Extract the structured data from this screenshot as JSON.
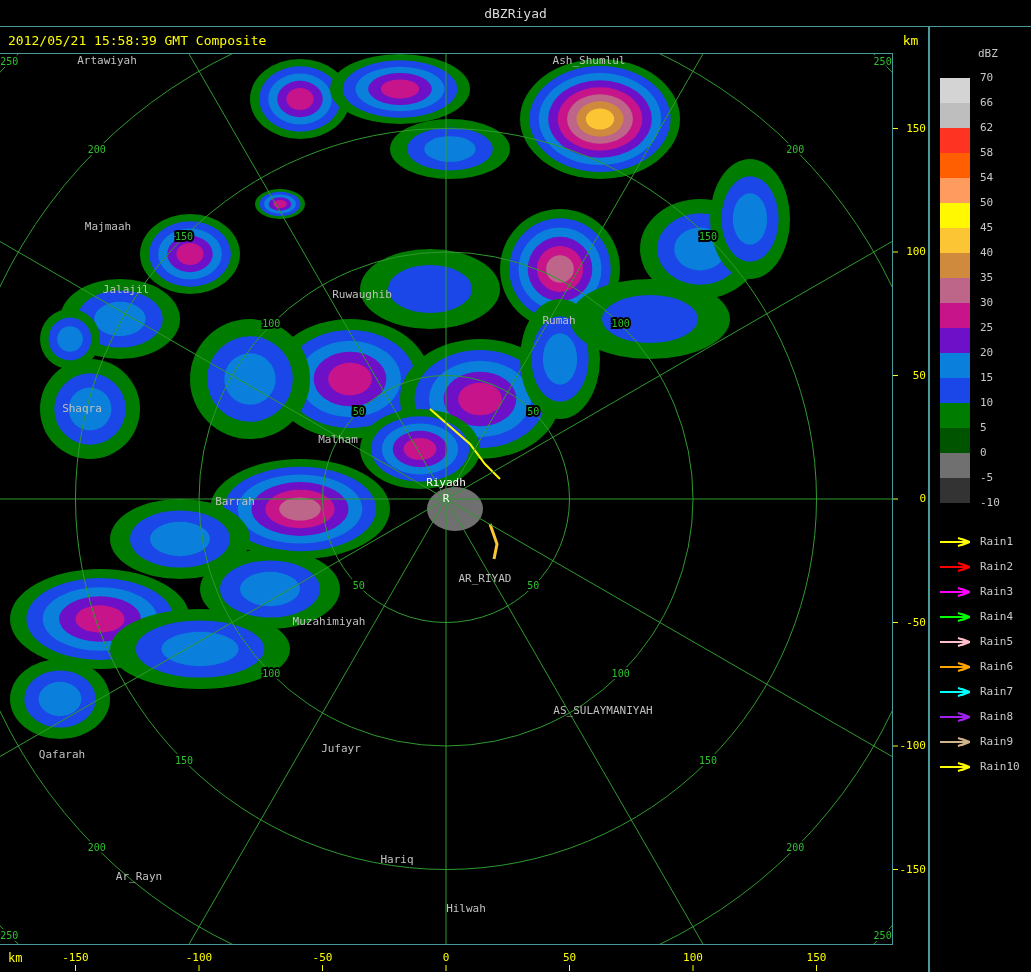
{
  "window": {
    "title": "dBZRiyad"
  },
  "header": {
    "timestamp": "2012/05/21 15:58:39 GMT Composite",
    "unit": "km"
  },
  "map": {
    "places": [
      {
        "name": "Artawiyah"
      },
      {
        "name": "Ash_Shumlul"
      },
      {
        "name": "Majmaah"
      },
      {
        "name": "Jalajil"
      },
      {
        "name": "Ruwaughib"
      },
      {
        "name": "Rumah"
      },
      {
        "name": "Shaqra"
      },
      {
        "name": "Malham"
      },
      {
        "name": "Barrah"
      },
      {
        "name": "AR_RIYAD"
      },
      {
        "name": "Muzahimiyah"
      },
      {
        "name": "AS_SULAYMANIYAH"
      },
      {
        "name": "Qafarah"
      },
      {
        "name": "Jufayr"
      },
      {
        "name": "Hariq"
      },
      {
        "name": "Ar_Rayn"
      },
      {
        "name": "Hilwah"
      }
    ],
    "site": {
      "name": "Riyadh",
      "marker": "R"
    },
    "range_rings": [
      {
        "labels": [
          "50",
          "50",
          "50",
          "50"
        ]
      },
      {
        "labels": [
          "100",
          "100",
          "100",
          "100"
        ]
      },
      {
        "labels": [
          "150",
          "150",
          "150",
          "150"
        ]
      },
      {
        "labels": [
          "200",
          "200",
          "200",
          "200"
        ]
      },
      {
        "labels": [
          "250",
          "250",
          "250",
          "250"
        ]
      }
    ]
  },
  "y_axis": {
    "ticks": [
      "150",
      "100",
      "50",
      "0",
      "-50",
      "-100",
      "-150"
    ]
  },
  "x_axis": {
    "unit": "km",
    "ticks": [
      "-150",
      "-100",
      "-50",
      "0",
      "50",
      "100",
      "150"
    ]
  },
  "legend": {
    "title": "dBZ",
    "bins": [
      {
        "color": "#d4d4d4"
      },
      {
        "color": "#bebebe"
      },
      {
        "color": "#ff3322"
      },
      {
        "color": "#ff5f00"
      },
      {
        "color": "#ff9b5f"
      },
      {
        "color": "#fff800"
      },
      {
        "color": "#fbc534"
      },
      {
        "color": "#cf8a3e"
      },
      {
        "color": "#bd668a"
      },
      {
        "color": "#c7148a"
      },
      {
        "color": "#6e10c8"
      },
      {
        "color": "#0a7fdc"
      },
      {
        "color": "#1b47e8"
      },
      {
        "color": "#007c00"
      },
      {
        "color": "#005400"
      },
      {
        "color": "#707070"
      },
      {
        "color": "#333333"
      }
    ],
    "labels": [
      "70",
      "66",
      "62",
      "58",
      "54",
      "50",
      "45",
      "40",
      "35",
      "30",
      "25",
      "20",
      "15",
      "10",
      "5",
      "0",
      "-5",
      "-10"
    ],
    "tracks": [
      {
        "label": "Rain1",
        "color": "#ffff00"
      },
      {
        "label": "Rain2",
        "color": "#ff0000"
      },
      {
        "label": "Rain3",
        "color": "#ff00ff"
      },
      {
        "label": "Rain4",
        "color": "#00ff00"
      },
      {
        "label": "Rain5",
        "color": "#ffc0cb"
      },
      {
        "label": "Rain6",
        "color": "#ffa500"
      },
      {
        "label": "Rain7",
        "color": "#00ffff"
      },
      {
        "label": "Rain8",
        "color": "#a020f0"
      },
      {
        "label": "Rain9",
        "color": "#d2b48c"
      },
      {
        "label": "Rain10",
        "color": "#ffff00"
      }
    ]
  }
}
